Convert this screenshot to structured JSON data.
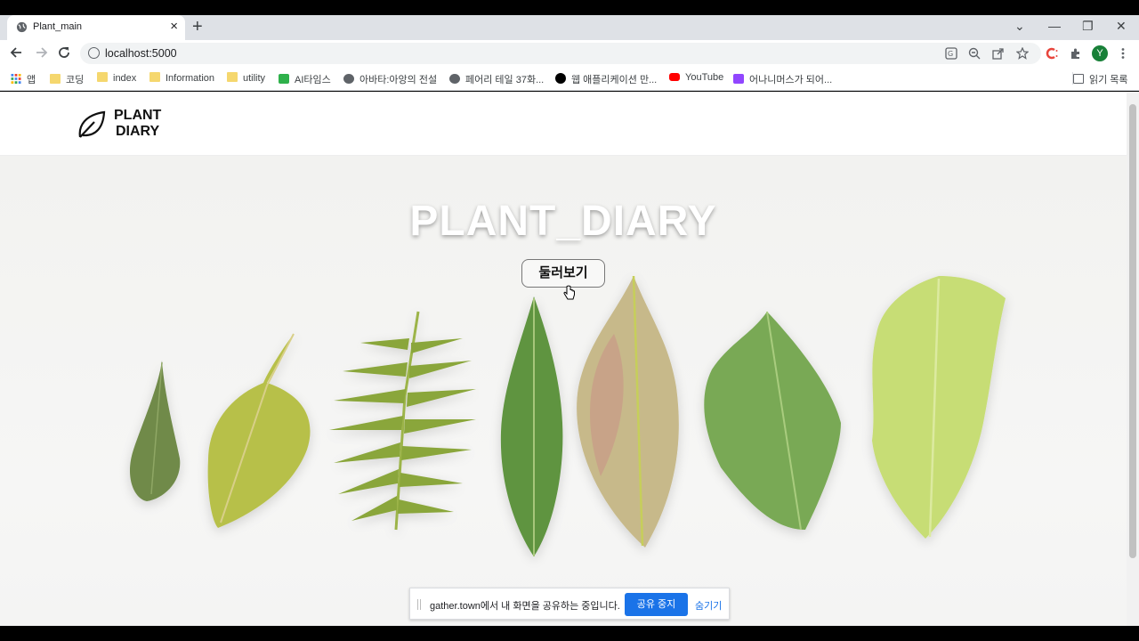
{
  "browser": {
    "tab_title": "Plant_main",
    "tab_close": "×",
    "new_tab": "+",
    "url": "localhost:5000",
    "window_controls": [
      "⌄",
      "—",
      "❐",
      "✕"
    ]
  },
  "bookmarks": [
    {
      "label": "앱",
      "icon": "apps-grid-icon"
    },
    {
      "label": "코딩",
      "icon": "folder-icon"
    },
    {
      "label": "index",
      "icon": "folder-icon"
    },
    {
      "label": "Information",
      "icon": "folder-icon"
    },
    {
      "label": "utility",
      "icon": "folder-icon"
    },
    {
      "label": "AI타임스",
      "icon": "aitimes-icon"
    },
    {
      "label": "아바타:아앙의 전설",
      "icon": "globe-icon"
    },
    {
      "label": "페어리 테일 37화...",
      "icon": "globe-icon"
    },
    {
      "label": "웹 애플리케이션 만...",
      "icon": "circle-icon"
    },
    {
      "label": "YouTube",
      "icon": "youtube-icon"
    },
    {
      "label": "어나니머스가 되어...",
      "icon": "twitch-icon"
    }
  ],
  "reading_list": "읽기 목록",
  "profile_initial": "Y",
  "page": {
    "logo_line1": "PLANT",
    "logo_line2": "DIARY",
    "hero_title": "PLANT_DIARY",
    "browse_button": "둘러보기"
  },
  "share_bar": {
    "message": "gather.town에서 내 화면을 공유하는 중입니다.",
    "stop_label": "공유 중지",
    "hide_label": "숨기기"
  },
  "colors": {
    "accent_blue": "#1a73e8",
    "profile_green": "#188038"
  }
}
